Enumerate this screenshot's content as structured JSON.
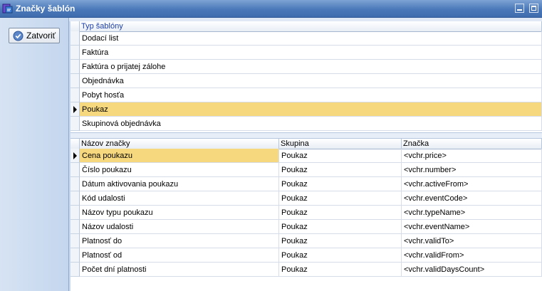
{
  "window": {
    "title": "Značky šablón",
    "icon": "app-icon"
  },
  "toolbar": {
    "close_label": "Zatvoriť"
  },
  "templates": {
    "header": "Typ šablóny",
    "rows": [
      "Dodací list",
      "Faktúra",
      "Faktúra o prijatej zálohe",
      "Objednávka",
      "Pobyt hosťa",
      "Poukaz",
      "Skupinová objednávka"
    ],
    "selected_index": 5
  },
  "tags": {
    "columns": [
      "Názov značky",
      "Skupina",
      "Značka"
    ],
    "rows": [
      [
        "Cena poukazu",
        "Poukaz",
        "<vchr.price>"
      ],
      [
        "Číslo poukazu",
        "Poukaz",
        "<vchr.number>"
      ],
      [
        "Dátum aktivovania poukazu",
        "Poukaz",
        "<vchr.activeFrom>"
      ],
      [
        "Kód udalosti",
        "Poukaz",
        "<vchr.eventCode>"
      ],
      [
        "Názov typu poukazu",
        "Poukaz",
        "<vchr.typeName>"
      ],
      [
        "Názov udalosti",
        "Poukaz",
        "<vchr.eventName>"
      ],
      [
        "Platnosť do",
        "Poukaz",
        "<vchr.validTo>"
      ],
      [
        "Platnosť od",
        "Poukaz",
        "<vchr.validFrom>"
      ],
      [
        "Počet dní platnosti",
        "Poukaz",
        "<vchr.validDaysCount>"
      ]
    ],
    "selected_index": 0
  },
  "colors": {
    "selection": "#f6d87e",
    "titlebar": "#4a78b8",
    "header_text": "#1d3fa8"
  }
}
